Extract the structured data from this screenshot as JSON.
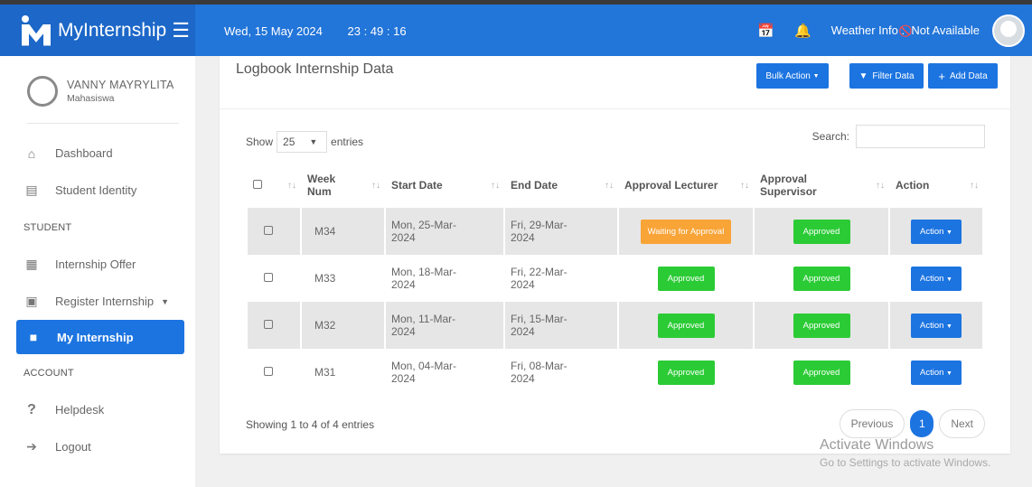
{
  "app": {
    "name": "MyInternship",
    "date": "Wed, 15 May 2024",
    "time": "23 : 49 : 16",
    "weather_label": "Weather Info :",
    "weather_value": "Not Available"
  },
  "user": {
    "name": "VANNY MAYRYLITA",
    "role": "Mahasiswa"
  },
  "nav": {
    "dashboard": "Dashboard",
    "student_identity": "Student Identity",
    "section_student": "STUDENT",
    "internship_offer": "Internship Offer",
    "register_internship": "Register Internship",
    "my_internship": "My Internship",
    "section_account": "ACCOUNT",
    "helpdesk": "Helpdesk",
    "logout": "Logout"
  },
  "page": {
    "title": "Logbook Internship Data",
    "bulk_action": "Bulk Action",
    "filter_data": "Filter Data",
    "add_data": "Add Data"
  },
  "table": {
    "show_label": "Show",
    "entries_label": "entries",
    "page_size": "25",
    "search_label": "Search:",
    "headers": {
      "week1": "Week",
      "week2": "Num",
      "start": "Start Date",
      "end": "End Date",
      "lecturer": "Approval Lecturer",
      "sup1": "Approval",
      "sup2": "Supervisor",
      "action": "Action"
    },
    "rows": [
      {
        "week": "M34",
        "start1": "Mon, 25-Mar-",
        "start2": "2024",
        "end1": "Fri, 29-Mar-",
        "end2": "2024",
        "lecturer": "Waiting for Approval",
        "supervisor": "Approved",
        "action": "Action"
      },
      {
        "week": "M33",
        "start1": "Mon, 18-Mar-",
        "start2": "2024",
        "end1": "Fri, 22-Mar-",
        "end2": "2024",
        "lecturer": "Approved",
        "supervisor": "Approved",
        "action": "Action"
      },
      {
        "week": "M32",
        "start1": "Mon, 11-Mar-",
        "start2": "2024",
        "end1": "Fri, 15-Mar-",
        "end2": "2024",
        "lecturer": "Approved",
        "supervisor": "Approved",
        "action": "Action"
      },
      {
        "week": "M31",
        "start1": "Mon, 04-Mar-",
        "start2": "2024",
        "end1": "Fri, 08-Mar-",
        "end2": "2024",
        "lecturer": "Approved",
        "supervisor": "Approved",
        "action": "Action"
      }
    ],
    "showing": "Showing 1 to 4 of 4 entries"
  },
  "pager": {
    "previous": "Previous",
    "current": "1",
    "next": "Next"
  },
  "watermark": {
    "line1": "Activate Windows",
    "line2": "Go to Settings to activate Windows."
  },
  "colors": {
    "primary": "#1c74e0",
    "approved": "#2bcb35",
    "waiting": "#f8a437"
  }
}
